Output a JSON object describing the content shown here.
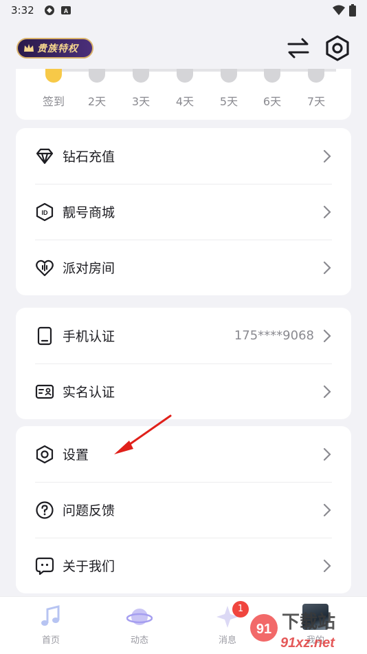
{
  "status": {
    "time": "3:32"
  },
  "header": {
    "vip_label": "贵族特权"
  },
  "checkin": {
    "days": [
      "签到",
      "2天",
      "3天",
      "4天",
      "5天",
      "6天",
      "7天"
    ]
  },
  "services": [
    {
      "label": "钻石充值",
      "icon": "diamond-icon"
    },
    {
      "label": "靓号商城",
      "icon": "id-badge-icon"
    },
    {
      "label": "派对房间",
      "icon": "party-heart-icon"
    }
  ],
  "account": [
    {
      "label": "手机认证",
      "value": "175****9068",
      "icon": "phone-icon"
    },
    {
      "label": "实名认证",
      "value": "",
      "icon": "id-card-icon"
    }
  ],
  "misc": [
    {
      "label": "设置",
      "icon": "settings-icon"
    },
    {
      "label": "问题反馈",
      "icon": "question-icon"
    },
    {
      "label": "关于我们",
      "icon": "chat-bubble-icon"
    }
  ],
  "nav": {
    "home": "首页",
    "feed": "动态",
    "messages": "消息",
    "messages_badge": "1",
    "me": "我的"
  },
  "watermark": {
    "line1": "下载站",
    "line2": "91xz.net",
    "num": "91"
  },
  "colors": {
    "accent": "#f0453e",
    "vip_gold": "#f4d58d",
    "arrow": "#e0201a"
  }
}
